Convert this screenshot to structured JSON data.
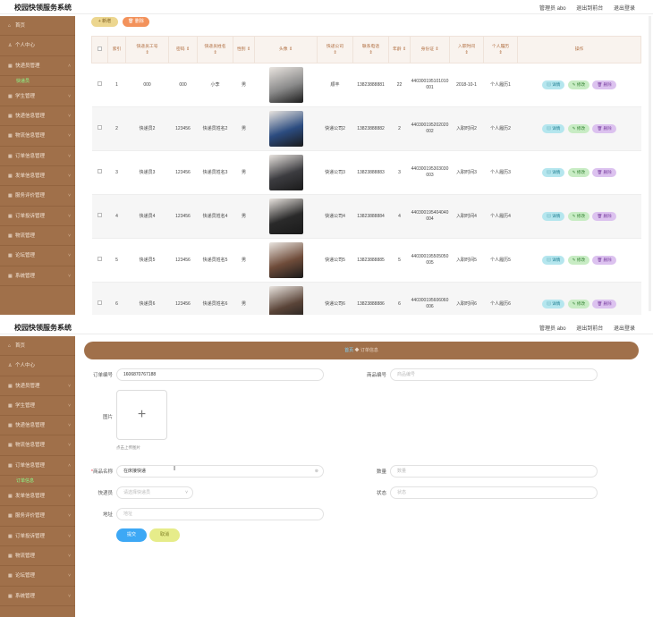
{
  "app": {
    "title": "校园快领服务系统",
    "admin": "管理员 abo",
    "goto_front": "退出到前台",
    "logout": "退出登录"
  },
  "sidebar": {
    "items": [
      {
        "label": "首页",
        "icon": "home-icon"
      },
      {
        "label": "个人中心",
        "icon": "user-icon"
      },
      {
        "label": "快递员管理",
        "icon": "grid-icon"
      },
      {
        "label": "快递员",
        "icon": ""
      },
      {
        "label": "学生管理",
        "icon": "grid-icon"
      },
      {
        "label": "快递信息管理",
        "icon": "grid-icon"
      },
      {
        "label": "物流信息管理",
        "icon": "grid-icon"
      },
      {
        "label": "订单信息管理",
        "icon": "grid-icon"
      },
      {
        "label": "发单信息管理",
        "icon": "grid-icon"
      },
      {
        "label": "服务评价管理",
        "icon": "grid-icon"
      },
      {
        "label": "订单投诉管理",
        "icon": "grid-icon"
      },
      {
        "label": "物流管理",
        "icon": "grid-icon"
      },
      {
        "label": "论坛管理",
        "icon": "grid-icon"
      },
      {
        "label": "系统管理",
        "icon": "grid-icon"
      }
    ],
    "items2": [
      {
        "label": "首页"
      },
      {
        "label": "个人中心"
      },
      {
        "label": "快递员管理"
      },
      {
        "label": "学生管理"
      },
      {
        "label": "快递信息管理"
      },
      {
        "label": "物流信息管理"
      },
      {
        "label": "订单信息管理"
      },
      {
        "label": "订单信息"
      },
      {
        "label": "发单信息管理"
      },
      {
        "label": "服务评价管理"
      },
      {
        "label": "订单投诉管理"
      },
      {
        "label": "物流管理"
      },
      {
        "label": "论坛管理"
      },
      {
        "label": "系统管理"
      }
    ]
  },
  "toolbar": {
    "add_label": "+ 新增",
    "delete_label": "删除"
  },
  "table": {
    "headers": [
      "",
      "索引",
      "快递员工号",
      "密码",
      "快递员姓名",
      "性别",
      "头像",
      "快递公司",
      "联系电话",
      "年龄",
      "身份证",
      "入职时间",
      "个人履历",
      "操作"
    ],
    "rows": [
      {
        "idx": "1",
        "no": "000",
        "pwd": "000",
        "name": "小李",
        "sex": "男",
        "company": "顺丰",
        "phone": "13823888881",
        "age": "22",
        "id": "440300195101010001",
        "date": "2018-10-1",
        "resume": "个人履历1",
        "avatar_color": "#8b8b8b"
      },
      {
        "idx": "2",
        "no": "快递员2",
        "pwd": "123456",
        "name": "快递员姓名2",
        "sex": "男",
        "company": "快递公司2",
        "phone": "13823888882",
        "age": "2",
        "id": "440300195202020002",
        "date": "入职时间2",
        "resume": "个人履历2",
        "avatar_color": "#2c4c80"
      },
      {
        "idx": "3",
        "no": "快递员3",
        "pwd": "123456",
        "name": "快递员姓名3",
        "sex": "男",
        "company": "快递公司3",
        "phone": "13823888883",
        "age": "3",
        "id": "440300195303030003",
        "date": "入职时间3",
        "resume": "个人履历3",
        "avatar_color": "#3c3c40"
      },
      {
        "idx": "4",
        "no": "快递员4",
        "pwd": "123456",
        "name": "快递员姓名4",
        "sex": "男",
        "company": "快递公司4",
        "phone": "13823888884",
        "age": "4",
        "id": "440300195404040004",
        "date": "入职时间4",
        "resume": "个人履历4",
        "avatar_color": "#2a2a2a"
      },
      {
        "idx": "5",
        "no": "快递员5",
        "pwd": "123456",
        "name": "快递员姓名5",
        "sex": "男",
        "company": "快递公司5",
        "phone": "13823888885",
        "age": "5",
        "id": "440300195505050005",
        "date": "入职时间5",
        "resume": "个人履历5",
        "avatar_color": "#6f4c3a"
      },
      {
        "idx": "6",
        "no": "快递员6",
        "pwd": "123456",
        "name": "快递员姓名6",
        "sex": "男",
        "company": "快递公司6",
        "phone": "13823888886",
        "age": "6",
        "id": "440300195606060006",
        "date": "入职时间6",
        "resume": "个人履历6",
        "avatar_color": "#5a4438"
      }
    ],
    "op_detail": "详情",
    "op_edit": "修改",
    "op_delete": "删除"
  },
  "form": {
    "breadcrumb_home": "首页",
    "breadcrumb_current": "订单信息",
    "order_no_label": "订单编号",
    "order_no_value": "1606870767188",
    "goods_no_label": "商品编号",
    "goods_no_placeholder": "商品编号",
    "image_label": "图片",
    "upload_tip": "点击上传图片",
    "goods_name_label": "商品名称",
    "goods_name_value": "在床接快递",
    "qty_label": "数量",
    "qty_placeholder": "数量",
    "courier_label": "快递员",
    "courier_placeholder": "请选择快递员",
    "status_label": "状态",
    "status_placeholder": "状态",
    "address_label": "地址",
    "address_placeholder": "地址",
    "submit_label": "提交",
    "cancel_label": "取消"
  }
}
